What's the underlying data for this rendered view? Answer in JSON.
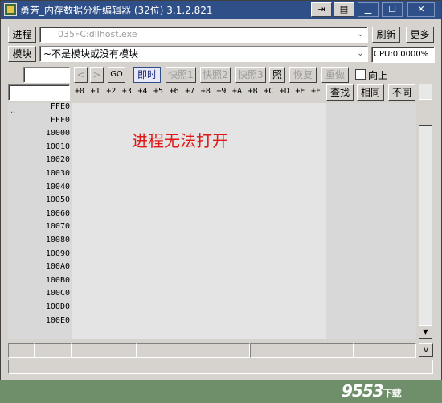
{
  "title": "勇芳_内存数据分析编辑器 (32位) 3.1.2.821",
  "titlebar_buttons": [
    "⇥",
    "▤",
    "▁",
    "☐",
    "✕"
  ],
  "toolbar": {
    "process_btn": "进程",
    "process_value": "035FC:dllhost.exe",
    "refresh_btn": "刷新",
    "more_btn": "更多",
    "module_btn": "模块",
    "module_value": "~不是模块或没有模块",
    "cpu": "CPU:0.0000%"
  },
  "nav": {
    "address_value": "",
    "back": "<",
    "forward": ">",
    "go": "GO",
    "immediate": "即时",
    "snap1": "快照1",
    "snap2": "快照2",
    "snap3": "快照3",
    "photo": "照",
    "restore": "恢复",
    "redo": "重做",
    "up_label": "向上"
  },
  "search": {
    "value": "",
    "find": "查找",
    "same": "相同",
    "diff": "不同"
  },
  "hex_columns": [
    "+0",
    "+1",
    "+2",
    "+3",
    "+4",
    "+5",
    "+6",
    "+7",
    "+8",
    "+9",
    "+A",
    "+B",
    "+C",
    "+D",
    "+E",
    "+F"
  ],
  "dots": "..",
  "addresses": [
    "FFE0",
    "FFF0",
    "10000",
    "10010",
    "10020",
    "10030",
    "10040",
    "10050",
    "10060",
    "10070",
    "10080",
    "10090",
    "100A0",
    "100B0",
    "100C0",
    "100D0",
    "100E0"
  ],
  "message": "进程无法打开",
  "scroll": {
    "up": "▲",
    "down": "▼"
  },
  "status_toggle": "V",
  "watermark": {
    "main": "9553",
    "sub": "下载"
  }
}
